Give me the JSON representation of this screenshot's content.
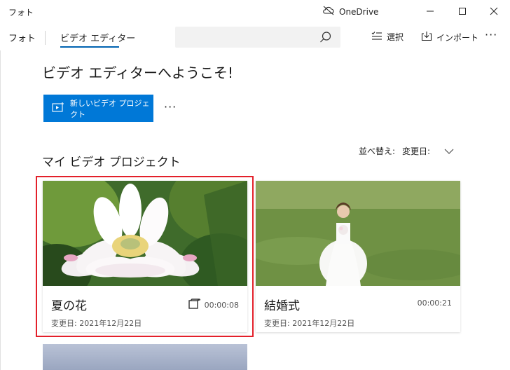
{
  "window": {
    "app_name": "フォト",
    "onedrive_label": "OneDrive",
    "icons": {
      "onedrive": "cloud-off-icon",
      "minimize": "minimize-icon",
      "maximize": "maximize-icon",
      "close": "close-icon"
    }
  },
  "nav": {
    "photos_label": "フォト",
    "editor_label": "ビデオ エディター",
    "search_placeholder": "",
    "select_label": "選択",
    "import_label": "インポート",
    "more_label": "···"
  },
  "main": {
    "title": "ビデオ エディターへようこそ!",
    "new_project_label": "新しいビデオ プロジェクト",
    "more_label": "···",
    "section_title": "マイ ビデオ プロジェクト",
    "sort_label": "並べ替え:",
    "sort_value": "変更日:"
  },
  "projects": [
    {
      "name": "夏の花",
      "duration": "00:00:08",
      "modified": "変更日: 2021年12月22日",
      "selected": true,
      "thumbnail": "white lotus flower"
    },
    {
      "name": "結婚式",
      "duration": "00:00:21",
      "modified": "変更日: 2021年12月22日",
      "selected": false,
      "thumbnail": "bride on grass"
    }
  ],
  "colors": {
    "accent": "#0078d7",
    "selection": "#e3202a"
  }
}
